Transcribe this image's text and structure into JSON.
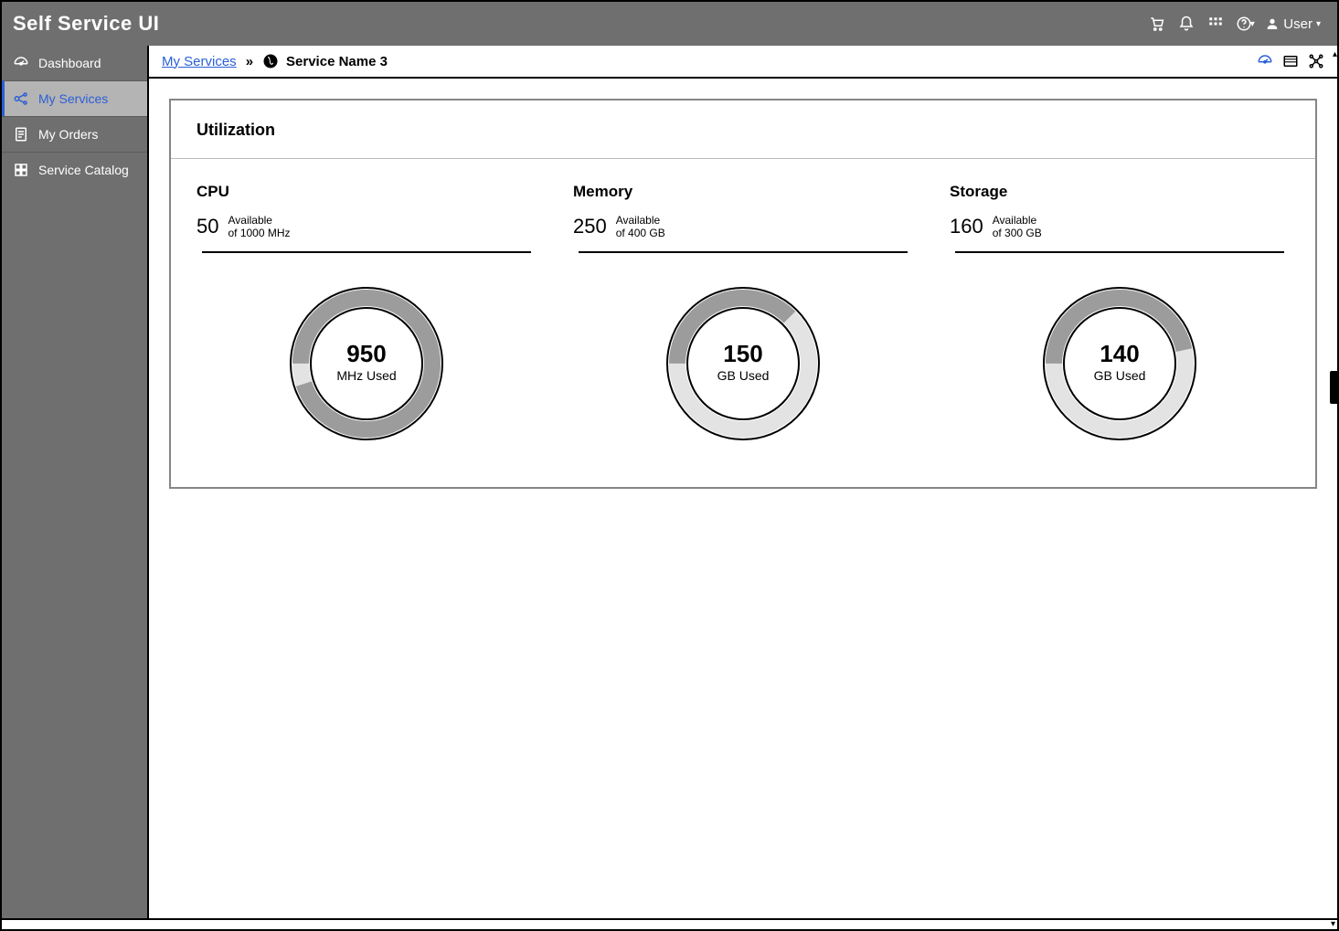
{
  "app_title": "Self Service UI",
  "topnav": {
    "user_label": "User"
  },
  "sidebar": {
    "items": [
      {
        "label": "Dashboard",
        "icon": "dashboard-icon"
      },
      {
        "label": "My Services",
        "icon": "services-icon",
        "active": true
      },
      {
        "label": "My Orders",
        "icon": "orders-icon"
      },
      {
        "label": "Service Catalog",
        "icon": "catalog-icon"
      }
    ]
  },
  "breadcrumb": {
    "parent": "My Services",
    "current": "Service Name 3"
  },
  "panel": {
    "title": "Utilization"
  },
  "chart_data": [
    {
      "type": "pie",
      "name": "CPU",
      "available": 50,
      "available_label": "Available",
      "total_label": "of 1000 MHz",
      "used": 950,
      "used_label": "MHz Used",
      "total": 1000,
      "fraction_used": 0.95
    },
    {
      "type": "pie",
      "name": "Memory",
      "available": 250,
      "available_label": "Available",
      "total_label": "of 400 GB",
      "used": 150,
      "used_label": "GB Used",
      "total": 400,
      "fraction_used": 0.375
    },
    {
      "type": "pie",
      "name": "Storage",
      "available": 160,
      "available_label": "Available",
      "total_label": "of 300 GB",
      "used": 140,
      "used_label": "GB Used",
      "total": 300,
      "fraction_used": 0.4667
    }
  ]
}
